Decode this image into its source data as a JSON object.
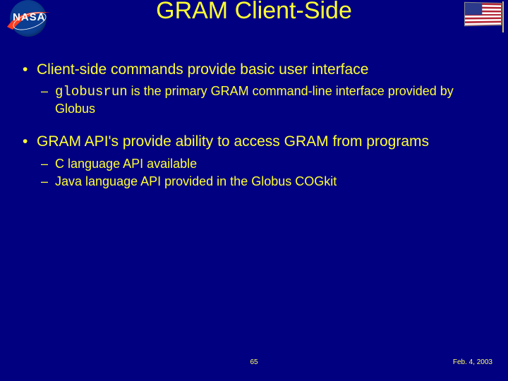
{
  "header": {
    "title": "GRAM Client-Side",
    "logo_left_text": "NASA"
  },
  "bullets": [
    {
      "text": "Client-side commands provide basic user interface",
      "sub": [
        {
          "code": "globusrun",
          "rest": " is the primary GRAM command-line interface provided by Globus"
        }
      ]
    },
    {
      "text": "GRAM API's provide ability to access GRAM from programs",
      "sub": [
        {
          "rest": "C language API available"
        },
        {
          "rest": "Java language API provided in the Globus COGkit"
        }
      ]
    }
  ],
  "footer": {
    "page": "65",
    "date": "Feb. 4, 2003"
  }
}
